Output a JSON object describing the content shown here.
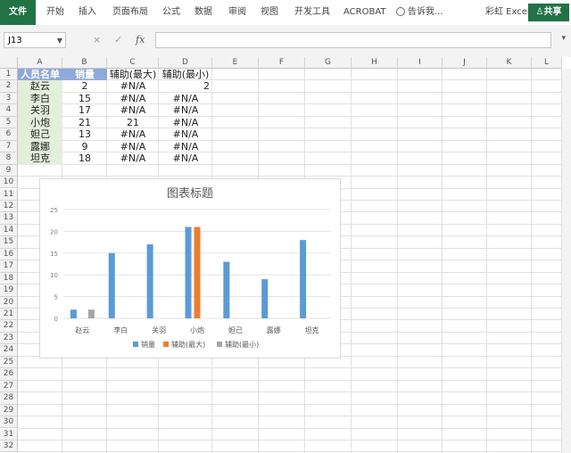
{
  "ribbon": {
    "tabs": [
      "文件",
      "开始",
      "插入",
      "页面布局",
      "公式",
      "数据",
      "审阅",
      "视图",
      "开发工具",
      "ACROBAT"
    ],
    "tell_me": "告诉我...",
    "user": "彩虹 Excel",
    "share": "共享"
  },
  "formula_bar": {
    "name_box": "J13",
    "fx": "fx",
    "cancel": "×",
    "enter": "✓",
    "value": ""
  },
  "columns": [
    "A",
    "B",
    "C",
    "D",
    "E",
    "F",
    "G",
    "H",
    "I",
    "J",
    "K",
    "L"
  ],
  "rows": [
    "1",
    "2",
    "3",
    "4",
    "5",
    "6",
    "7",
    "8",
    "9",
    "10",
    "11",
    "12",
    "13",
    "14",
    "15",
    "16",
    "17",
    "18",
    "19",
    "20",
    "21",
    "22",
    "23",
    "24",
    "25",
    "26",
    "27",
    "28",
    "29",
    "30",
    "31",
    "32"
  ],
  "table": {
    "headers": [
      "人员名单",
      "销量",
      "辅助(最大)",
      "辅助(最小)"
    ],
    "data": [
      [
        "赵云",
        "2",
        "#N/A",
        "2"
      ],
      [
        "李白",
        "15",
        "#N/A",
        "#N/A"
      ],
      [
        "关羽",
        "17",
        "#N/A",
        "#N/A"
      ],
      [
        "小炮",
        "21",
        "21",
        "#N/A"
      ],
      [
        "妲己",
        "13",
        "#N/A",
        "#N/A"
      ],
      [
        "露娜",
        "9",
        "#N/A",
        "#N/A"
      ],
      [
        "坦克",
        "18",
        "#N/A",
        "#N/A"
      ]
    ]
  },
  "colors": {
    "brand": "#217346",
    "header_fill": "#8ea9db",
    "name_fill": "#e2efda",
    "s1": "#5b9bd5",
    "s2": "#ed7d31",
    "s3": "#a5a5a5"
  },
  "chart_data": {
    "type": "bar",
    "title": "图表标题",
    "categories": [
      "赵云",
      "李白",
      "关羽",
      "小炮",
      "妲己",
      "露娜",
      "坦克"
    ],
    "series": [
      {
        "name": "销量",
        "values": [
          2,
          15,
          17,
          21,
          13,
          9,
          18
        ]
      },
      {
        "name": "辅助(最大)",
        "values": [
          null,
          null,
          null,
          21,
          null,
          null,
          null
        ]
      },
      {
        "name": "辅助(最小)",
        "values": [
          2,
          null,
          null,
          null,
          null,
          null,
          null
        ]
      }
    ],
    "ylim": [
      0,
      25
    ],
    "yticks": [
      "0",
      "5",
      "10",
      "15",
      "20",
      "25"
    ],
    "grid": true,
    "legend": "bottom"
  }
}
